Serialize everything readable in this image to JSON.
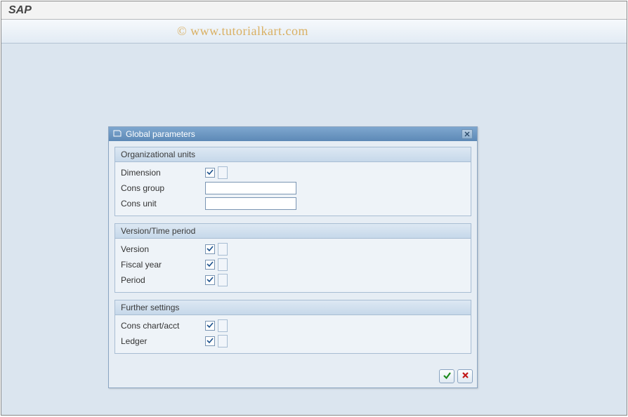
{
  "app": {
    "title": "SAP"
  },
  "watermark": "© www.tutorialkart.com",
  "dialog": {
    "title": "Global parameters",
    "groups": {
      "org": {
        "title": "Organizational units",
        "dimension_label": "Dimension",
        "cons_group_label": "Cons group",
        "cons_group_value": "",
        "cons_unit_label": "Cons unit",
        "cons_unit_value": ""
      },
      "time": {
        "title": "Version/Time period",
        "version_label": "Version",
        "fiscal_year_label": "Fiscal year",
        "period_label": "Period"
      },
      "further": {
        "title": "Further settings",
        "cons_chart_label": "Cons chart/acct",
        "ledger_label": "Ledger"
      }
    }
  }
}
